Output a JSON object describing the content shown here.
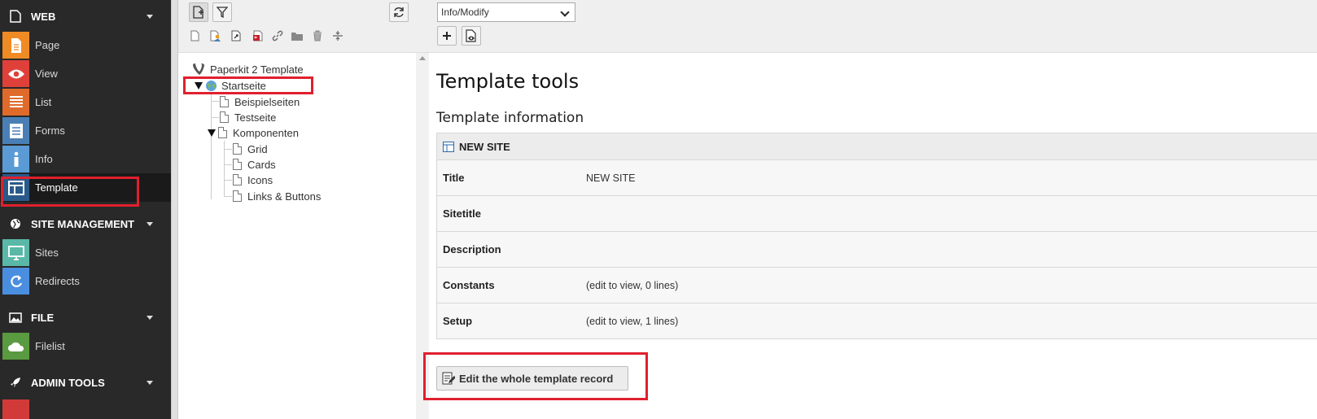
{
  "sidebar": {
    "groups": [
      {
        "label": "WEB",
        "icon": "page-icon"
      },
      {
        "label": "SITE MANAGEMENT",
        "icon": "globe-icon"
      },
      {
        "label": "FILE",
        "icon": "image-icon"
      },
      {
        "label": "ADMIN TOOLS",
        "icon": "rocket-icon"
      }
    ],
    "modules": [
      {
        "label": "Page",
        "icon": "page-module-icon",
        "color": "#f08a24"
      },
      {
        "label": "View",
        "icon": "eye-icon",
        "color": "#e0403a"
      },
      {
        "label": "List",
        "icon": "list-icon",
        "color": "#e06a2a"
      },
      {
        "label": "Forms",
        "icon": "forms-icon",
        "color": "#4a7fb5"
      },
      {
        "label": "Info",
        "icon": "info-icon",
        "color": "#5b9bd5"
      },
      {
        "label": "Template",
        "icon": "template-icon",
        "color": "#2a5a8a"
      },
      {
        "label": "Sites",
        "icon": "sites-icon",
        "color": "#5ab8a8"
      },
      {
        "label": "Redirects",
        "icon": "redirect-icon",
        "color": "#4a8ee0"
      },
      {
        "label": "Filelist",
        "icon": "cloud-icon",
        "color": "#5a9a40"
      }
    ]
  },
  "tree": {
    "root": "Paperkit 2 Template",
    "nodes": [
      {
        "label": "Startseite",
        "level": 0
      },
      {
        "label": "Beispielseiten",
        "level": 1
      },
      {
        "label": "Testseite",
        "level": 1
      },
      {
        "label": "Komponenten",
        "level": 1
      },
      {
        "label": "Grid",
        "level": 2
      },
      {
        "label": "Cards",
        "level": 2
      },
      {
        "label": "Icons",
        "level": 2
      },
      {
        "label": "Links & Buttons",
        "level": 2
      }
    ]
  },
  "content": {
    "function_select": "Info/Modify",
    "title": "Template tools",
    "subtitle": "Template information",
    "table_head": "NEW SITE",
    "rows": [
      {
        "key": "Title",
        "value": "NEW SITE"
      },
      {
        "key": "Sitetitle",
        "value": ""
      },
      {
        "key": "Description",
        "value": ""
      },
      {
        "key": "Constants",
        "value": "(edit to view, 0 lines)"
      },
      {
        "key": "Setup",
        "value": "(edit to view, 1 lines)"
      }
    ],
    "edit_button": "Edit the whole template record"
  },
  "colors": {
    "highlight": "#e0202e",
    "sidebar_bg": "#292929"
  }
}
